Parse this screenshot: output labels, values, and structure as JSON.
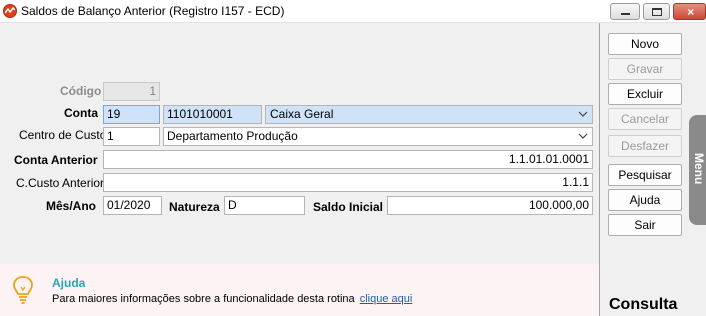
{
  "window": {
    "title": "Saldos de Balanço Anterior (Registro I157 - ECD)",
    "minimize_icon": "minimize-icon",
    "maximize_icon": "maximize-icon",
    "close_icon": "close-icon",
    "close_glyph": "×"
  },
  "form": {
    "codigo": {
      "label": "Código",
      "value": "1"
    },
    "conta": {
      "label": "Conta",
      "code": "19",
      "number": "1101010001",
      "name": "Caixa Geral"
    },
    "centro_custo": {
      "label": "Centro de Custo",
      "code": "1",
      "name": "Departamento Produção"
    },
    "conta_anterior": {
      "label": "Conta Anterior",
      "value": "1.1.01.01.0001"
    },
    "ccusto_anterior": {
      "label": "C.Custo Anterior",
      "value": "1.1.1"
    },
    "mes_ano": {
      "label": "Mês/Ano",
      "value": "01/2020"
    },
    "natureza": {
      "label": "Natureza",
      "value": "D"
    },
    "saldo_inicial": {
      "label": "Saldo Inicial",
      "value": "100.000,00"
    }
  },
  "actions": {
    "novo": "Novo",
    "gravar": "Gravar",
    "excluir": "Excluir",
    "cancelar": "Cancelar",
    "desfazer": "Desfazer",
    "pesquisar": "Pesquisar",
    "ajuda": "Ajuda",
    "sair": "Sair"
  },
  "menu_tab": "Menu",
  "consulta_label": "Consulta",
  "help": {
    "title": "Ajuda",
    "text": "Para maiores informações sobre a funcionalidade desta rotina",
    "link": "clique aqui",
    "icon": "lightbulb-icon"
  },
  "colors": {
    "selected_field": "#cfe2f8",
    "help_background": "#fdf2f4",
    "help_title": "#2aa6b3",
    "link": "#1a5fb4",
    "close_button": "#c94a35"
  }
}
